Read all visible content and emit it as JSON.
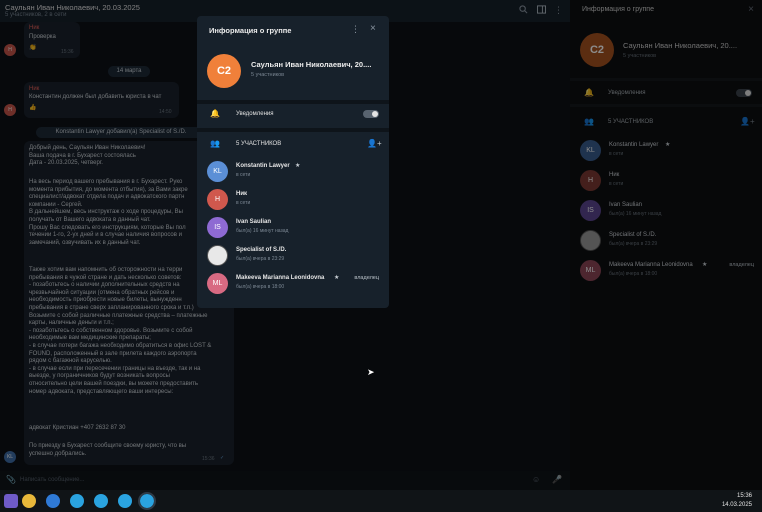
{
  "chat": {
    "title": "Саульян Иван Николаевич, 20.03.2025",
    "subtitle": "5 участников, 2 в сети",
    "messages": [
      {
        "sender": "Ник",
        "text": "Проверка",
        "time": "15:36"
      },
      {
        "sender": "Ник",
        "text": "Константин должен был добавить юриста в чат",
        "time": "14:50"
      }
    ],
    "date_pill": "14 марта",
    "service_pill": "Konstantin Lawyer добавил(а) Specialist of S./D.",
    "long_message": {
      "para1": "Добрый день, Саульян Иван Николаевич!\nВаша подача в г. Бухарест состоялась\nДата - 20.03.2025, четверг.",
      "para2": "На весь период вашего пребывания в г. Бухарест. Руко\nмомента прибытия, до момента отбытия), за Вами закре\nспециалист/адвокат отдела подач и адвокатского партн\nкомпании - Сергей.\nВ дальнейшем, весь инструктаж о ходе процедуры, Вы\nполучать от Вашего адвоката в данный чат.\nПрошу Вас следовать его инструкциям, которые Вы пол\nтечении 1-го, 2-ух дней и в случае наличия вопросов и\nзамечаний, озвучивать их в данный чат.",
      "para3": "Также хотим вам напомнить об осторожности на терри\nпребывания в чужой стране и дать несколько советов:\n- позаботьтесь о наличии дополнительных средств на\nчрезвычайной ситуации (отмена обратных рейсов и\nнеобходимость приобрести новые билеты, вынужденн\nпребывания в стране сверх запланированного срока и т.п.)\nВозьмите с собой различные платежные средства – платежные\nкарты, наличные деньги и т.п.;\n- позаботьтесь о собственном здоровье. Возьмите с собой\nнеобходимые вам медицинские препараты;\n- в случае потери багажа необходимо обратиться в офис LOST &\nFOUND, расположенный в зале прилета каждого аэропорта\nрядом с багажной каруселью.\n- в случае если при пересечении границы на въезде, так и на\nвыезде, у пограничников будут возникать вопросы\nотносительно цели вашей поездки, вы можете предоставить\nномер адвоката, представляющего ваши интересы:",
      "para4": "адвокат Кристиан +407 2632 87 30",
      "para5": "По приезду в Бухарест сообщите своему юристу, что вы\nуспешно добрались.",
      "time": "15:36"
    },
    "composer_placeholder": "Написать сообщение..."
  },
  "modal": {
    "title": "Информация о группе",
    "group_avatar": "С2",
    "group_name": "Саульян Иван Николаевич, 20....",
    "group_members": "5 участников",
    "notifications_label": "Уведомления",
    "members_header": "5 УЧАСТНИКОВ",
    "members": [
      {
        "initials": "KL",
        "name": "Konstantin Lawyer",
        "status": "в сети",
        "color": "#5b8fd6",
        "star": "★",
        "role": ""
      },
      {
        "initials": "Н",
        "name": "Ник",
        "status": "в сети",
        "color": "#d0584d",
        "star": "",
        "role": ""
      },
      {
        "initials": "IS",
        "name": "Ivan Saulian",
        "status": "был(а) 16 минут назад",
        "color": "#8e6ad3",
        "star": "",
        "role": ""
      },
      {
        "initials": "",
        "name": "Specialist of S./D.",
        "status": "был(а) вчера в 23:29",
        "color": "#e8e8e8",
        "star": "",
        "role": ""
      },
      {
        "initials": "ML",
        "name": "Makeeva Marianna Leonidovna",
        "status": "был(а) вчера в 18:00",
        "color": "#d86a82",
        "star": "★",
        "role": "владелец"
      }
    ]
  },
  "right_panel": {
    "title": "Информация о группе",
    "group_avatar": "С2",
    "group_name": "Саульян Иван Николаевич, 20....",
    "group_members": "5 участников",
    "notifications_label": "Уведомления",
    "members_header": "5 УЧАСТНИКОВ",
    "members": [
      {
        "initials": "KL",
        "name": "Konstantin Lawyer",
        "status": "в сети",
        "color": "#3a5e8e",
        "star": "★",
        "role": ""
      },
      {
        "initials": "Н",
        "name": "Ник",
        "status": "в сети",
        "color": "#7d3a34",
        "star": "",
        "role": ""
      },
      {
        "initials": "IS",
        "name": "Ivan Saulian",
        "status": "был(а) 16 минут назад",
        "color": "#5b4590",
        "star": "",
        "role": ""
      },
      {
        "initials": "",
        "name": "Specialist of S./D.",
        "status": "был(а) вчера в 23:29",
        "color": "#9a9a9a",
        "star": "",
        "role": ""
      },
      {
        "initials": "ML",
        "name": "Makeeva Marianna Leonidovna",
        "status": "был(а) вчера в 18:00",
        "color": "#8c4657",
        "star": "★",
        "role": "владелец"
      }
    ]
  },
  "taskbar": {
    "time": "15:36",
    "date": "14.03.2025"
  }
}
